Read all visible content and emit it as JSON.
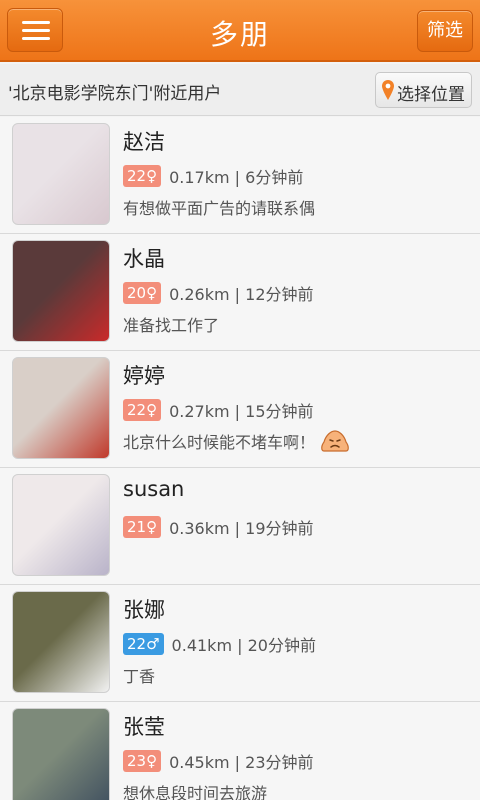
{
  "header": {
    "title": "多朋",
    "filter_label": "筛选"
  },
  "location": {
    "text": "'北京电影学院东门'附近用户",
    "button_label": "选择位置"
  },
  "users": [
    {
      "name": "赵洁",
      "age": "22",
      "gender_symbol": "♀",
      "gender": "female",
      "distance": "0.17km",
      "time": "6分钟前",
      "status": "有想做平面广告的请联系偶",
      "avatar_colors": [
        "#e9e2e6",
        "#d8c8cf"
      ]
    },
    {
      "name": "水晶",
      "age": "20",
      "gender_symbol": "♀",
      "gender": "female",
      "distance": "0.26km",
      "time": "12分钟前",
      "status": "准备找工作了",
      "avatar_colors": [
        "#5a3a3a",
        "#c92a2a"
      ]
    },
    {
      "name": "婷婷",
      "age": "22",
      "gender_symbol": "♀",
      "gender": "female",
      "distance": "0.27km",
      "time": "15分钟前",
      "status": "北京什么时候能不堵车啊！",
      "has_emoji": true,
      "avatar_colors": [
        "#d9cfc8",
        "#c0392b"
      ]
    },
    {
      "name": "susan",
      "age": "21",
      "gender_symbol": "♀",
      "gender": "female",
      "distance": "0.36km",
      "time": "19分钟前",
      "status": "",
      "avatar_colors": [
        "#efe9ea",
        "#b9b3c9"
      ]
    },
    {
      "name": "张娜",
      "age": "22",
      "gender_symbol": "♂",
      "gender": "male",
      "distance": "0.41km",
      "time": "20分钟前",
      "status": "丁香",
      "avatar_colors": [
        "#6a6a4a",
        "#f2f2f2"
      ]
    },
    {
      "name": "张莹",
      "age": "23",
      "gender_symbol": "♀",
      "gender": "female",
      "distance": "0.45km",
      "time": "23分钟前",
      "status": "想休息段时间去旅游",
      "avatar_colors": [
        "#7d8a7a",
        "#3f4f5f"
      ]
    }
  ],
  "colors": {
    "accent": "#f28127",
    "female_badge": "#f38e7a",
    "male_badge": "#3a9be2"
  }
}
